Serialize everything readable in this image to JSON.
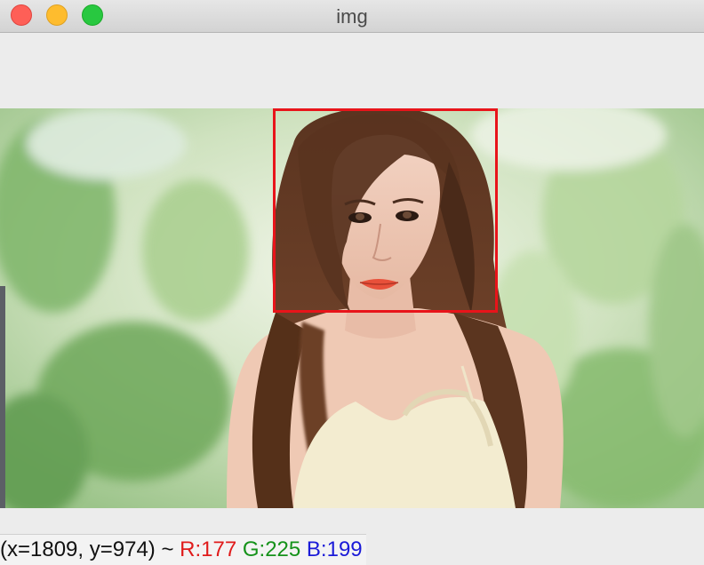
{
  "window": {
    "title": "img"
  },
  "overlay": {
    "box_color": "#e8141a"
  },
  "status": {
    "coords": "(x=1809, y=974) ~ ",
    "r": "R:177",
    "g": "G:225",
    "b": "B:199",
    "colors": {
      "r": "#e01b1b",
      "g": "#15921a",
      "b": "#1b1bd8"
    }
  }
}
